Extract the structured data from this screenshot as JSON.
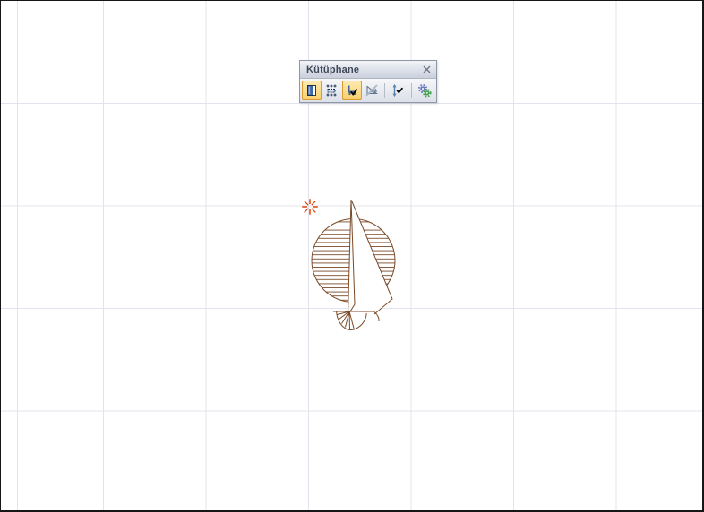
{
  "window": {
    "background": "#ffffff",
    "grid_color": "#e3e3ee",
    "border_color": "#161616"
  },
  "toolbar": {
    "title": "Kütüphane",
    "close_icon": "close-x",
    "buttons": [
      {
        "name": "library-part-button",
        "icon": "book-icon",
        "selected": true
      },
      {
        "name": "hotspots-button",
        "icon": "hotspots-icon",
        "selected": false
      },
      {
        "name": "place-object-button",
        "icon": "chair-check-icon",
        "selected": true
      },
      {
        "name": "no-parameters-button",
        "icon": "slashed-triangle-gear-icon",
        "selected": false
      },
      {
        "name": "stretch-height-button",
        "icon": "vertical-arrow-check-icon",
        "selected": false
      },
      {
        "name": "settings-button",
        "icon": "gears-icon",
        "selected": false
      }
    ],
    "selected_accent": "#dc9a30"
  },
  "canvas": {
    "drawing": "tree-plan-symbol",
    "drawing_color": "#7b4a28",
    "origin_marker": "eight-ray-asterisk",
    "origin_marker_color": "#e2440e"
  }
}
